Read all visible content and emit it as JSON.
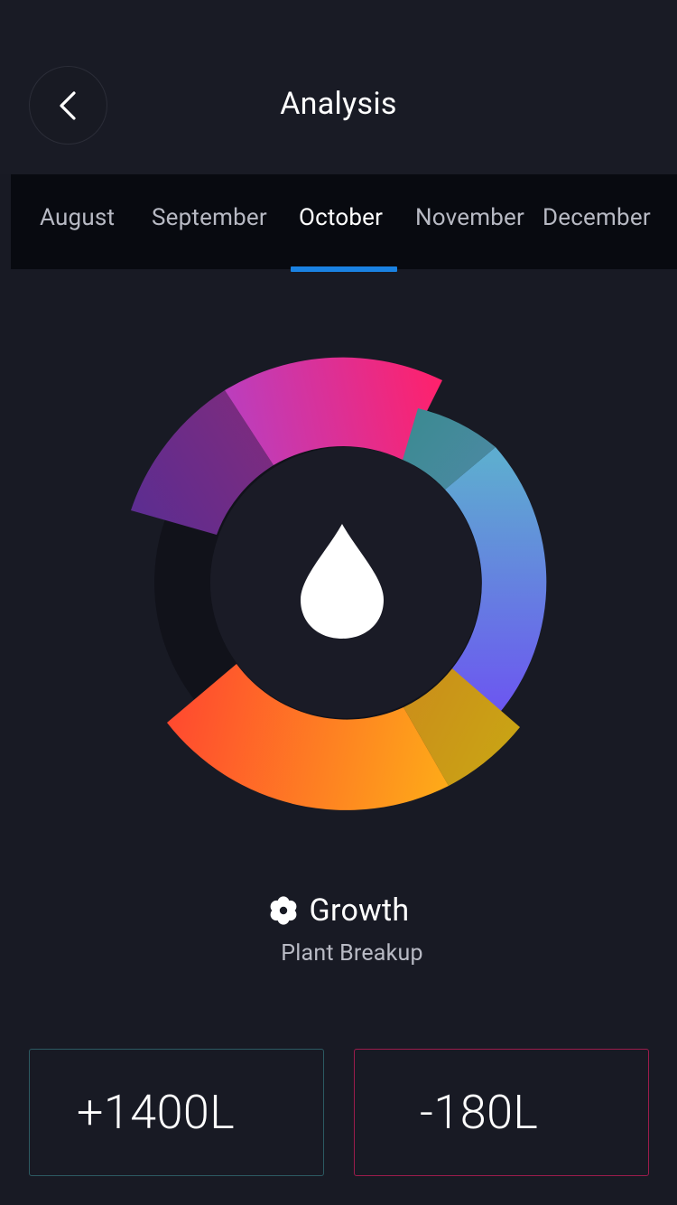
{
  "header": {
    "title": "Analysis",
    "back_icon": "chevron-left-icon"
  },
  "tabs": [
    {
      "label": "August",
      "active": false
    },
    {
      "label": "September",
      "active": false
    },
    {
      "label": "October",
      "active": true
    },
    {
      "label": "November",
      "active": false
    },
    {
      "label": "December",
      "active": false
    }
  ],
  "ring": {
    "center_icon": "water-drop-icon",
    "colors": {
      "track": "#12131c",
      "accent_tab": "#1a82e2"
    }
  },
  "growth": {
    "icon": "flower-icon",
    "label": "Growth",
    "sublabel": "Plant Breakup"
  },
  "stats": {
    "inflow": "+1400L",
    "outflow": "-180L",
    "inflow_border": "#2c5a62",
    "outflow_border": "#9b1c4c"
  }
}
